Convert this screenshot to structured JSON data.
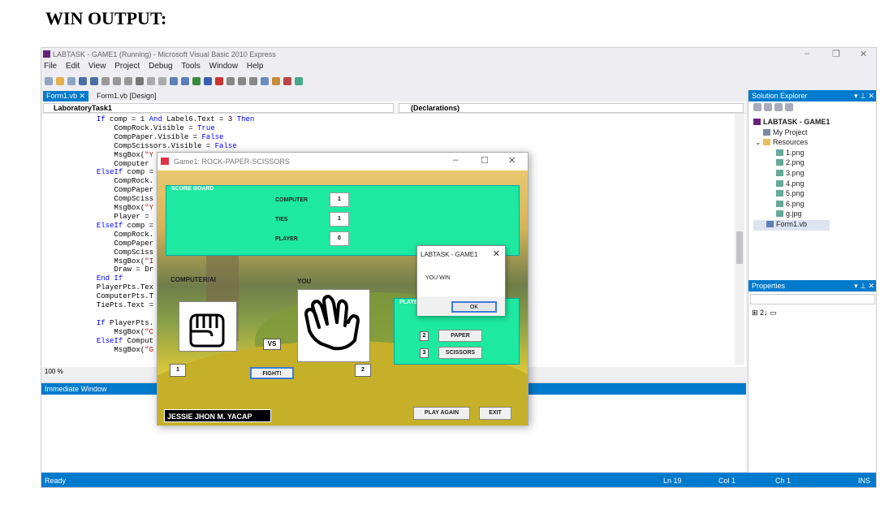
{
  "heading": "WIN OUTPUT:",
  "ide": {
    "title": "LABTASK - GAME1 (Running) - Microsoft Visual Basic 2010 Express",
    "menu": [
      "File",
      "Edit",
      "View",
      "Project",
      "Debug",
      "Tools",
      "Window",
      "Help"
    ],
    "tabs": [
      "Form1.vb",
      "Form1.vb [Design]"
    ],
    "nav_left": "LaboratoryTask1",
    "nav_right": "(Declarations)",
    "zoom": "100 %",
    "immediate_title": "Immediate Window",
    "solution_title": "Solution Explorer",
    "solution_tree": [
      "LABTASK - GAME1",
      "My Project",
      "Resources",
      "1.png",
      "2.png",
      "3.png",
      "4.png",
      "5.png",
      "6.png",
      "g.jpg",
      "Form1.vb"
    ],
    "properties_title": "Properties",
    "status": {
      "ready": "Ready",
      "ln": "Ln 19",
      "col": "Col 1",
      "ch": "Ch 1",
      "ins": "INS"
    }
  },
  "game": {
    "title": "Game1: ROCK-PAPER-SCISSORS",
    "score_board_title": "SCORE BOARD",
    "scores": [
      {
        "label": "COMPUTER",
        "value": "1"
      },
      {
        "label": "TIES",
        "value": "1"
      },
      {
        "label": "PLAYER",
        "value": "0"
      }
    ],
    "computer_label": "COMPUTER/AI",
    "you_label": "YOU",
    "vs": "VS",
    "computer_num": "1",
    "player_num": "2",
    "fight": "FIGHT!",
    "player_panel_title": "PLAYE",
    "choices": [
      {
        "num": "2",
        "label": "PAPER"
      },
      {
        "num": "3",
        "label": "SCISSORS"
      }
    ],
    "author": "JESSIE JHON M. YACAP",
    "play_again": "PLAY AGAIN",
    "exit": "EXIT"
  },
  "msgbox": {
    "title": "LABTASK - GAME1",
    "message": "YOU WIN",
    "ok": "OK"
  },
  "colors": {
    "accent": "#007acc",
    "green_panel": "#1de9a1"
  }
}
